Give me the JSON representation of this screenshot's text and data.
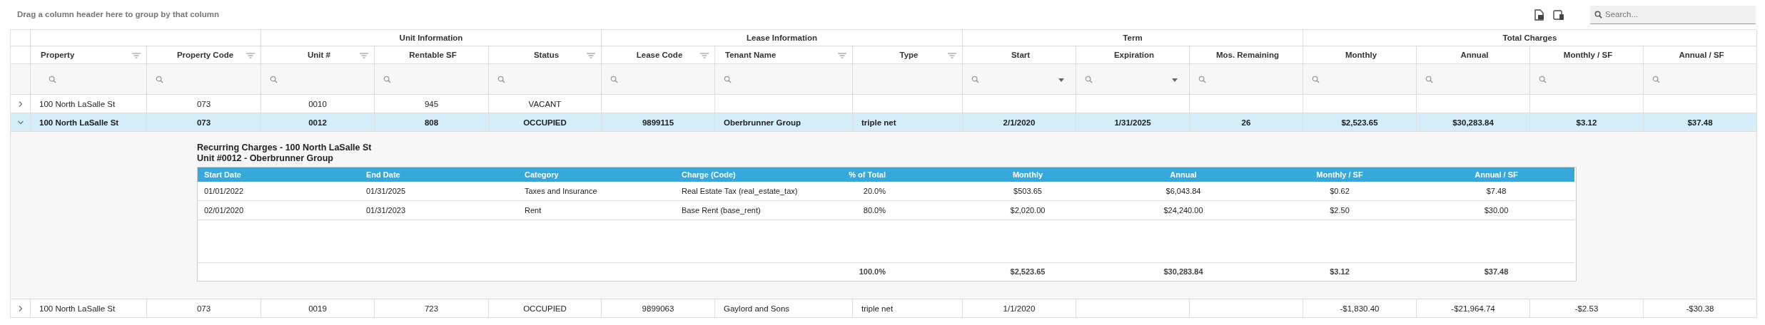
{
  "toolbar": {
    "group_hint": "Drag a column header here to group by that column",
    "search": {
      "placeholder": "Search..."
    }
  },
  "column_groups": [
    {
      "columns": [
        {
          "label": "Property",
          "menu": true,
          "search_filter": true,
          "date_picker": false
        },
        {
          "label": "Property Code",
          "menu": true,
          "search_filter": true,
          "date_picker": false
        }
      ]
    },
    {
      "label": "Unit Information",
      "columns": [
        {
          "label": "Unit #",
          "menu": true,
          "search_filter": true,
          "date_picker": false
        },
        {
          "label": "Rentable SF",
          "menu": false,
          "search_filter": true,
          "date_picker": false
        },
        {
          "label": "Status",
          "menu": true,
          "search_filter": true,
          "date_picker": false
        }
      ]
    },
    {
      "label": "Lease Information",
      "columns": [
        {
          "label": "Lease Code",
          "menu": true,
          "search_filter": true,
          "date_picker": false
        },
        {
          "label": "Tenant Name",
          "menu": true,
          "search_filter": true,
          "date_picker": false
        },
        {
          "label": "Type",
          "menu": true,
          "search_filter": false,
          "date_picker": false
        }
      ]
    },
    {
      "label": "Term",
      "columns": [
        {
          "label": "Start",
          "menu": false,
          "search_filter": true,
          "date_picker": true
        },
        {
          "label": "Expiration",
          "menu": false,
          "search_filter": true,
          "date_picker": true
        },
        {
          "label": "Mos. Remaining",
          "menu": false,
          "search_filter": true,
          "date_picker": false
        }
      ]
    },
    {
      "label": "Total Charges",
      "columns": [
        {
          "label": "Monthly",
          "menu": false,
          "search_filter": true,
          "date_picker": false
        },
        {
          "label": "Annual",
          "menu": false,
          "search_filter": true,
          "date_picker": false
        },
        {
          "label": "Monthly / SF",
          "menu": false,
          "search_filter": true,
          "date_picker": false
        },
        {
          "label": "Annual / SF",
          "menu": false,
          "search_filter": true,
          "date_picker": false
        }
      ]
    }
  ],
  "rows": [
    {
      "expanded": false,
      "selected": false,
      "property": "100 North LaSalle St",
      "property_code": "073",
      "unit": "0010",
      "rentable_sf": "945",
      "status": "VACANT"
    },
    {
      "expanded": true,
      "selected": true,
      "property": "100 North LaSalle St",
      "property_code": "073",
      "unit": "0012",
      "rentable_sf": "808",
      "status": "OCCUPIED",
      "lease_code": "9899115",
      "tenant_name": "Oberbrunner Group",
      "type": "triple net",
      "start": "2/1/2020",
      "expiration": "1/31/2025",
      "mos_remaining": "26",
      "monthly": "$2,523.65",
      "annual": "$30,283.84",
      "monthly_sf": "$3.12",
      "annual_sf": "$37.48",
      "detail": {
        "title": "Recurring Charges - 100 North LaSalle St",
        "subtitle": "Unit #0012 - Oberbrunner Group",
        "columns": [
          "Start Date",
          "End Date",
          "Category",
          "Charge (Code)",
          "% of Total",
          "Monthly",
          "Annual",
          "Monthly / SF",
          "Annual / SF"
        ],
        "rows": [
          [
            "01/01/2022",
            "01/31/2025",
            "Taxes and Insurance",
            "Real Estate Tax (real_estate_tax)",
            "20.0%",
            "$503.65",
            "$6,043.84",
            "$0.62",
            "$7.48"
          ],
          [
            "02/01/2020",
            "01/31/2023",
            "Rent",
            "Base Rent (base_rent)",
            "80.0%",
            "$2,020.00",
            "$24,240.00",
            "$2.50",
            "$30.00"
          ]
        ],
        "totals": {
          "percent": "100.0%",
          "monthly": "$2,523.65",
          "annual": "$30,283.84",
          "monthly_sf": "$3.12",
          "annual_sf": "$37.48"
        }
      }
    },
    {
      "expanded": false,
      "selected": false,
      "property": "100 North LaSalle St",
      "property_code": "073",
      "unit": "0019",
      "rentable_sf": "723",
      "status": "OCCUPIED",
      "lease_code": "9899063",
      "tenant_name": "Gaylord and Sons",
      "type": "triple net",
      "start": "1/1/2020",
      "monthly": "-$1,830.40",
      "annual": "-$21,964.74",
      "monthly_sf": "-$2.53",
      "annual_sf": "-$30.38"
    }
  ]
}
